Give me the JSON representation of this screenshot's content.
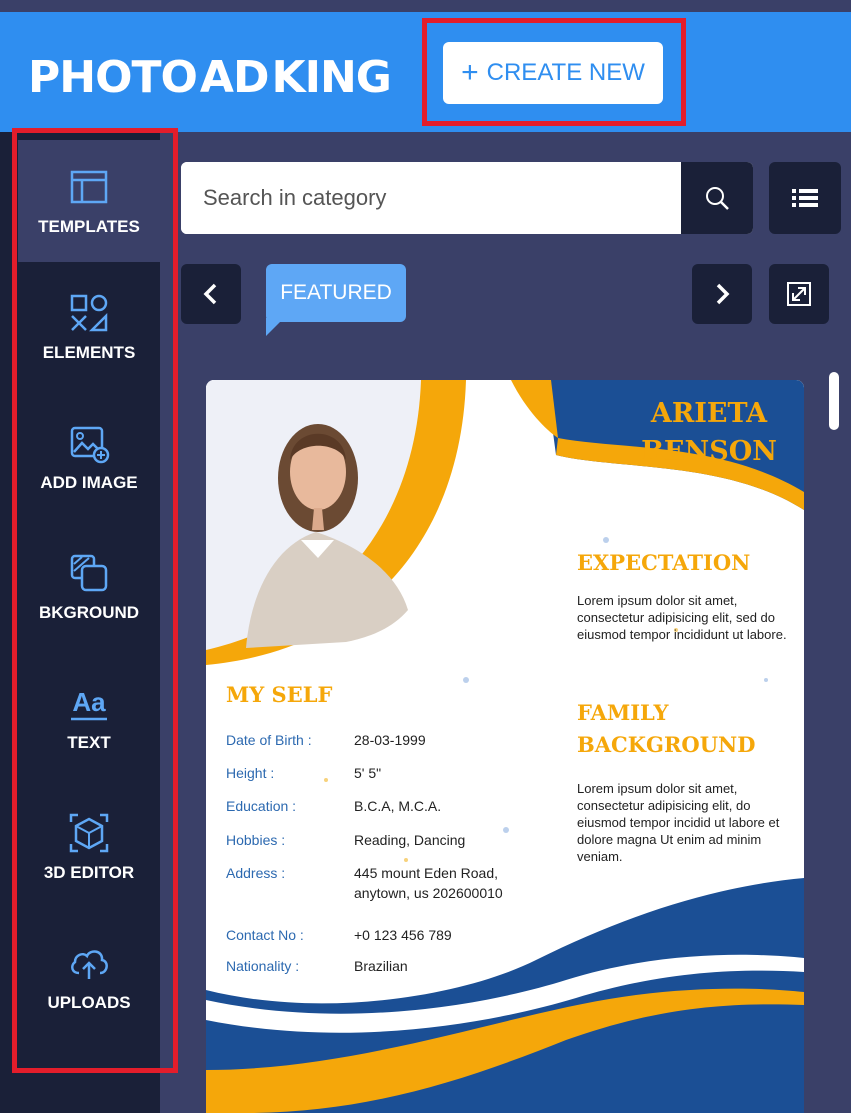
{
  "header": {
    "logo_text_left": "PHOTO",
    "logo_mark": "AD",
    "logo_text_right": "KING",
    "create_new_plus": "+",
    "create_new_label": "CREATE NEW"
  },
  "sidebar": {
    "items": [
      {
        "label": "TEMPLATES",
        "icon": "templates-icon",
        "active": true
      },
      {
        "label": "ELEMENTS",
        "icon": "elements-icon"
      },
      {
        "label": "ADD IMAGE",
        "icon": "add-image-icon"
      },
      {
        "label": "BKGROUND",
        "icon": "background-icon"
      },
      {
        "label": "TEXT",
        "icon": "text-icon"
      },
      {
        "label": "3D EDITOR",
        "icon": "3d-editor-icon"
      },
      {
        "label": "UPLOADS",
        "icon": "cloud-upload-icon"
      }
    ]
  },
  "search": {
    "placeholder": "Search in category",
    "search_icon": "search-icon",
    "view_icon": "list-view-icon"
  },
  "category_bar": {
    "prev_icon": "chevron-left-icon",
    "active_category": "FEATURED",
    "next_icon": "chevron-right-icon",
    "expand_icon": "expand-icon"
  },
  "template": {
    "name_line1": "ARIETA",
    "name_line2": "BENSON",
    "expectation_title": "EXPECTATION",
    "expectation_text": "Lorem ipsum dolor sit amet, consectetur adipisicing elit, sed do eiusmod tempor incididunt ut labore.",
    "family_title_line1": "FAMILY",
    "family_title_line2": "BACKGROUND",
    "family_text": "Lorem ipsum dolor sit amet, consectetur adipisicing elit, do eiusmod tempor incidid ut labore et dolore magna Ut enim ad minim veniam.",
    "myself_title": "MY SELF",
    "details": [
      {
        "label": "Date of Birth :",
        "value": "28-03-1999"
      },
      {
        "label": "Height :",
        "value": "5' 5\""
      },
      {
        "label": "Education :",
        "value": "B.C.A, M.C.A."
      },
      {
        "label": "Hobbies :",
        "value": "Reading, Dancing"
      },
      {
        "label": "Address :",
        "value": "445 mount Eden Road,",
        "value2": "anytown, us 202600010"
      },
      {
        "label": "Contact No :",
        "value": "+0 123 456 789"
      },
      {
        "label": "Nationality :",
        "value": "Brazilian"
      }
    ]
  },
  "colors": {
    "header_blue": "#2f8ef0",
    "sidebar_dark": "#1a2038",
    "panel_bg": "#3a4068",
    "accent_orange": "#f5a70a",
    "template_navy": "#1b4f95",
    "highlight_red": "#e31d2b"
  }
}
